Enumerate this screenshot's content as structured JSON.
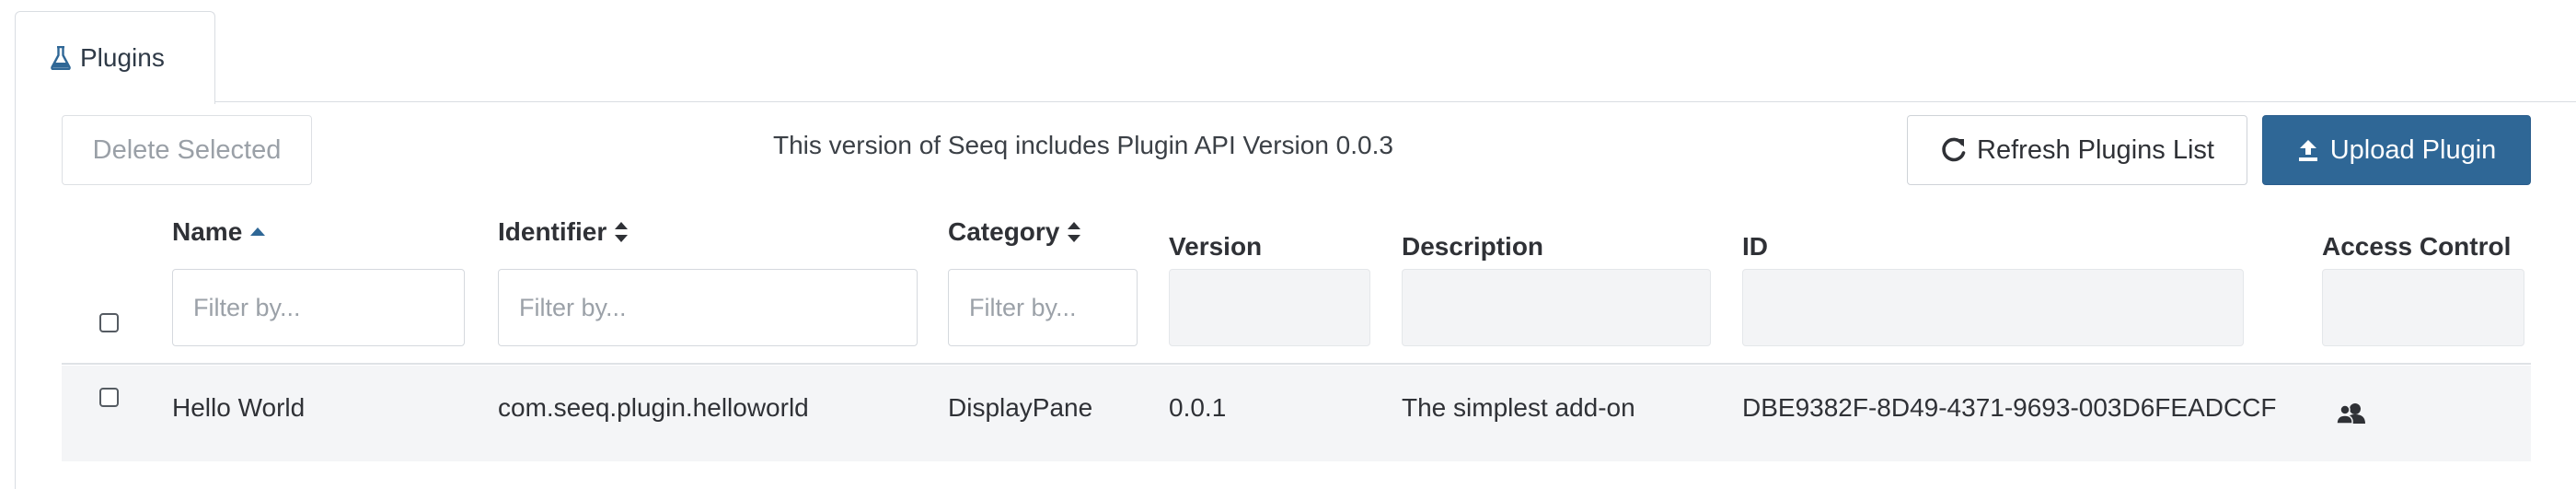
{
  "tab": {
    "icon": "flask-icon",
    "label": "Plugins"
  },
  "toolbar": {
    "delete_label": "Delete Selected",
    "api_note": "This version of Seeq includes Plugin API Version 0.0.3",
    "refresh_label": "Refresh Plugins List",
    "refresh_icon": "refresh-icon",
    "upload_label": "Upload Plugin",
    "upload_icon": "upload-icon"
  },
  "table": {
    "columns": {
      "name": "Name",
      "identifier": "Identifier",
      "category": "Category",
      "version": "Version",
      "description": "Description",
      "id": "ID",
      "access_control": "Access Control"
    },
    "sort": {
      "name": "ascending",
      "identifier": "sortable",
      "category": "sortable"
    },
    "filter_placeholder": "Filter by...",
    "rows": [
      {
        "name": "Hello World",
        "identifier": "com.seeq.plugin.helloworld",
        "category": "DisplayPane",
        "version": "0.0.1",
        "description": "The simplest add-on",
        "id": "DBE9382F-8D49-4371-9693-003D6FEADCCF",
        "access_icon": "users-icon",
        "checked": false
      }
    ]
  },
  "colors": {
    "primary": "#2f6796",
    "row_background": "#f4f5f7",
    "border": "#d9dde2"
  }
}
